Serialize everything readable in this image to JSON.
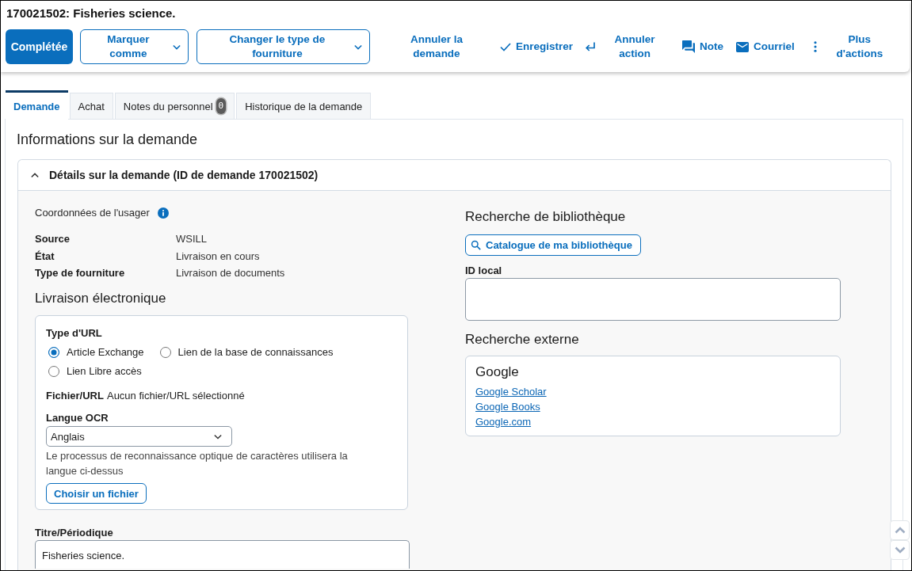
{
  "page": {
    "title": "170021502: Fisheries science."
  },
  "toolbar": [
    {
      "kind": "primary",
      "label": "Complétée"
    },
    {
      "kind": "menu",
      "label": "Marquer comme"
    },
    {
      "kind": "menu",
      "label": "Changer le type de fourniture"
    },
    {
      "kind": "plain",
      "label": "Annuler la demande"
    },
    {
      "kind": "check",
      "label": "Enregistrer"
    },
    {
      "kind": "undo",
      "label": "Annuler action"
    },
    {
      "kind": "chat",
      "label": "Note"
    },
    {
      "kind": "mail",
      "label": "Courriel"
    },
    {
      "kind": "more",
      "label": "Plus d'actions"
    }
  ],
  "tabs": [
    {
      "label": "Demande",
      "selected": true
    },
    {
      "label": "Achat",
      "selected": false
    },
    {
      "label": "Notes du personnel",
      "badge": "0",
      "selected": false
    },
    {
      "label": "Historique de la demande",
      "selected": false
    }
  ],
  "section": {
    "title": "Informations sur la demande"
  },
  "accordion": {
    "title": "Détails sur la demande (ID de demande 170021502)",
    "expanded": true
  },
  "patron": {
    "label": "Coordonnées de l'usager"
  },
  "details": [
    {
      "label": "Source",
      "value": "WSILL"
    },
    {
      "label": "État",
      "value": "Livraison en cours"
    },
    {
      "label": "Type de fourniture",
      "value": "Livraison de documents"
    }
  ],
  "electronic_delivery": {
    "title": "Livraison électronique",
    "url_type": {
      "label": "Type d'URL",
      "options": [
        {
          "label": "Article Exchange",
          "selected": true
        },
        {
          "label": "Lien de la base de connaissances",
          "selected": false
        },
        {
          "label": "Lien Libre accès",
          "selected": false
        }
      ]
    },
    "file": {
      "label": "Fichier/URL",
      "value": "Aucun fichier/URL sélectionné"
    },
    "ocr_language": {
      "label": "Langue OCR",
      "value": "Anglais",
      "help": "Le processus de reconnaissance optique de caractères utilisera la langue ci-dessus"
    },
    "choose_file_button": "Choisir un fichier"
  },
  "title_field": {
    "label": "Titre/Périodique",
    "value": "Fisheries science."
  },
  "library_search": {
    "title": "Recherche de bibliothèque",
    "catalog_button": "Catalogue de ma bibliothèque",
    "local_id": {
      "label": "ID local"
    }
  },
  "external_search": {
    "title": "Recherche externe",
    "provider": "Google",
    "links": [
      "Google Scholar",
      "Google Books",
      "Google.com"
    ]
  }
}
